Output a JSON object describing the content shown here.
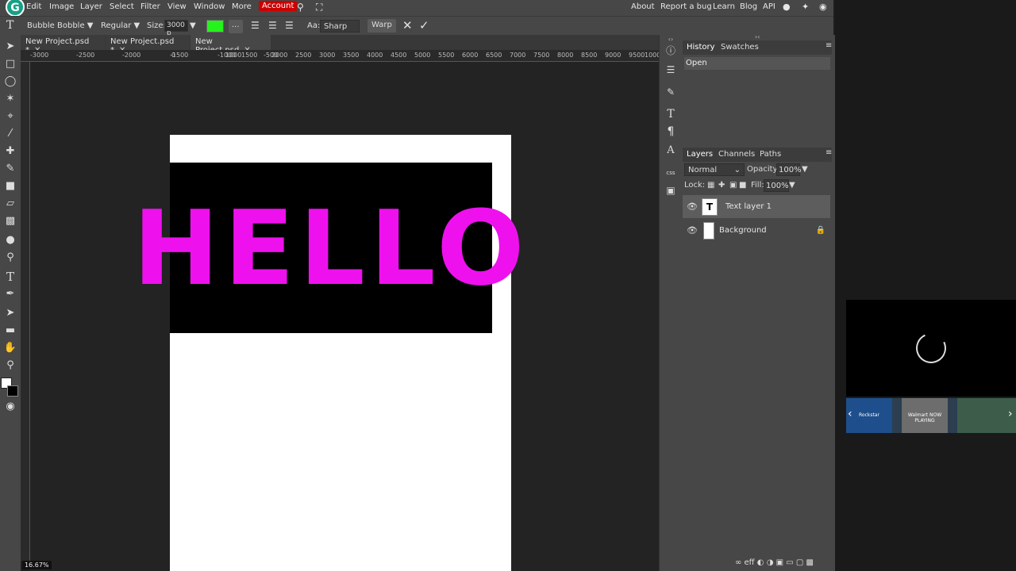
{
  "menubar": {
    "logo": "G",
    "items": [
      "Edit",
      "Image",
      "Layer",
      "Select",
      "Filter",
      "View",
      "Window",
      "More",
      "Account"
    ],
    "right_links": [
      "About",
      "Report a bug",
      "Learn",
      "Blog",
      "API"
    ]
  },
  "options": {
    "font_family": "Bubble Bobble",
    "font_style": "Regular",
    "size_label": "Size:",
    "size_value": "3000 p",
    "color": "#26f21c",
    "more_label": "...",
    "aa_label": "Aa:",
    "aa_value": "Sharp",
    "warp_label": "Warp"
  },
  "tabs": [
    {
      "label": "New Project.psd *"
    },
    {
      "label": "New Project.psd *"
    },
    {
      "label": "New Project.psd"
    }
  ],
  "ruler_ticks": [
    "-3000",
    "-2500",
    "-2000",
    "-1500",
    "-1000",
    "-500",
    "0",
    "1000",
    "1500",
    "2000",
    "2500",
    "3000",
    "3500",
    "4000",
    "4500",
    "5000",
    "5500",
    "6000",
    "6500",
    "7000",
    "7500",
    "8000",
    "8500",
    "9000",
    "9500",
    "1000"
  ],
  "canvas": {
    "text": "HELLO",
    "text_color": "#ee11ee",
    "bg_color": "#000000",
    "zoom": "16.67%"
  },
  "history": {
    "tabs": [
      "History",
      "Swatches"
    ],
    "items": [
      "Open"
    ]
  },
  "layers": {
    "tabs": [
      "Layers",
      "Channels",
      "Paths"
    ],
    "blend_mode": "Normal",
    "opacity_label": "Opacity:",
    "opacity_value": "100%",
    "lock_label": "Lock:",
    "fill_label": "Fill:",
    "fill_value": "100%",
    "items": [
      {
        "name": "Text layer 1",
        "thumb": "T"
      },
      {
        "name": "Background",
        "thumb": ""
      }
    ],
    "footer": "eff"
  },
  "sidebar_icons": [
    "info-icon",
    "sliders-icon",
    "brush-icon",
    "text-icon",
    "paragraph-icon",
    "glyph-icon",
    "css",
    "image-icon"
  ],
  "ads": {
    "thumb1": "Rockstar",
    "thumb2": "Walmart NOW PLAYING",
    "thumb3": ""
  }
}
